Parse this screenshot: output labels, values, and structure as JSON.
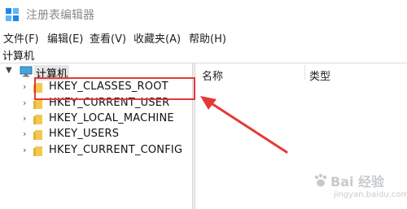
{
  "window": {
    "title": "注册表编辑器",
    "icon": "regedit-icon"
  },
  "menu": {
    "items": [
      {
        "label": "文件(F)"
      },
      {
        "label": "编辑(E)"
      },
      {
        "label": "查看(V)"
      },
      {
        "label": "收藏夹(A)"
      },
      {
        "label": "帮助(H)"
      }
    ]
  },
  "address": {
    "path": "计算机"
  },
  "tree": {
    "root": {
      "label": "计算机",
      "icon": "computer-icon",
      "expanded": true
    },
    "keys": [
      {
        "label": "HKEY_CLASSES_ROOT"
      },
      {
        "label": "HKEY_CURRENT_USER"
      },
      {
        "label": "HKEY_LOCAL_MACHINE"
      },
      {
        "label": "HKEY_USERS"
      },
      {
        "label": "HKEY_CURRENT_CONFIG"
      }
    ]
  },
  "list": {
    "columns": [
      "名称",
      "类型"
    ]
  },
  "annotation": {
    "color": "#e53935",
    "highlighted_key": "HKEY_CLASSES_ROOT"
  },
  "watermark": {
    "main": "Bai 经验",
    "sub": "jingyan.baidu.com"
  }
}
